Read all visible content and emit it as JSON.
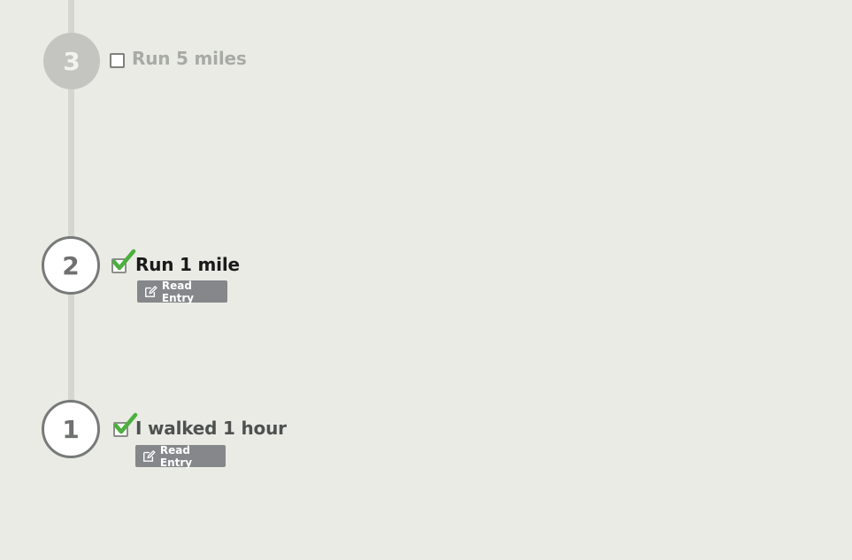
{
  "steps": [
    {
      "number": "3",
      "title": "Run 5 miles",
      "completed": false
    },
    {
      "number": "2",
      "title": "Run 1 mile",
      "completed": true,
      "entry_button_label": "Read Entry"
    },
    {
      "number": "1",
      "title": "I walked 1 hour",
      "completed": true,
      "entry_button_label": "Read Entry"
    }
  ],
  "colors": {
    "background": "#e9ebe4",
    "timeline": "#d4d6cf",
    "pending_circle": "#c4c5c0",
    "check_green": "#4caf3f",
    "entry_button": "#85878a"
  },
  "icons": {
    "checkmark": "checkmark-icon",
    "edit": "edit-icon"
  }
}
